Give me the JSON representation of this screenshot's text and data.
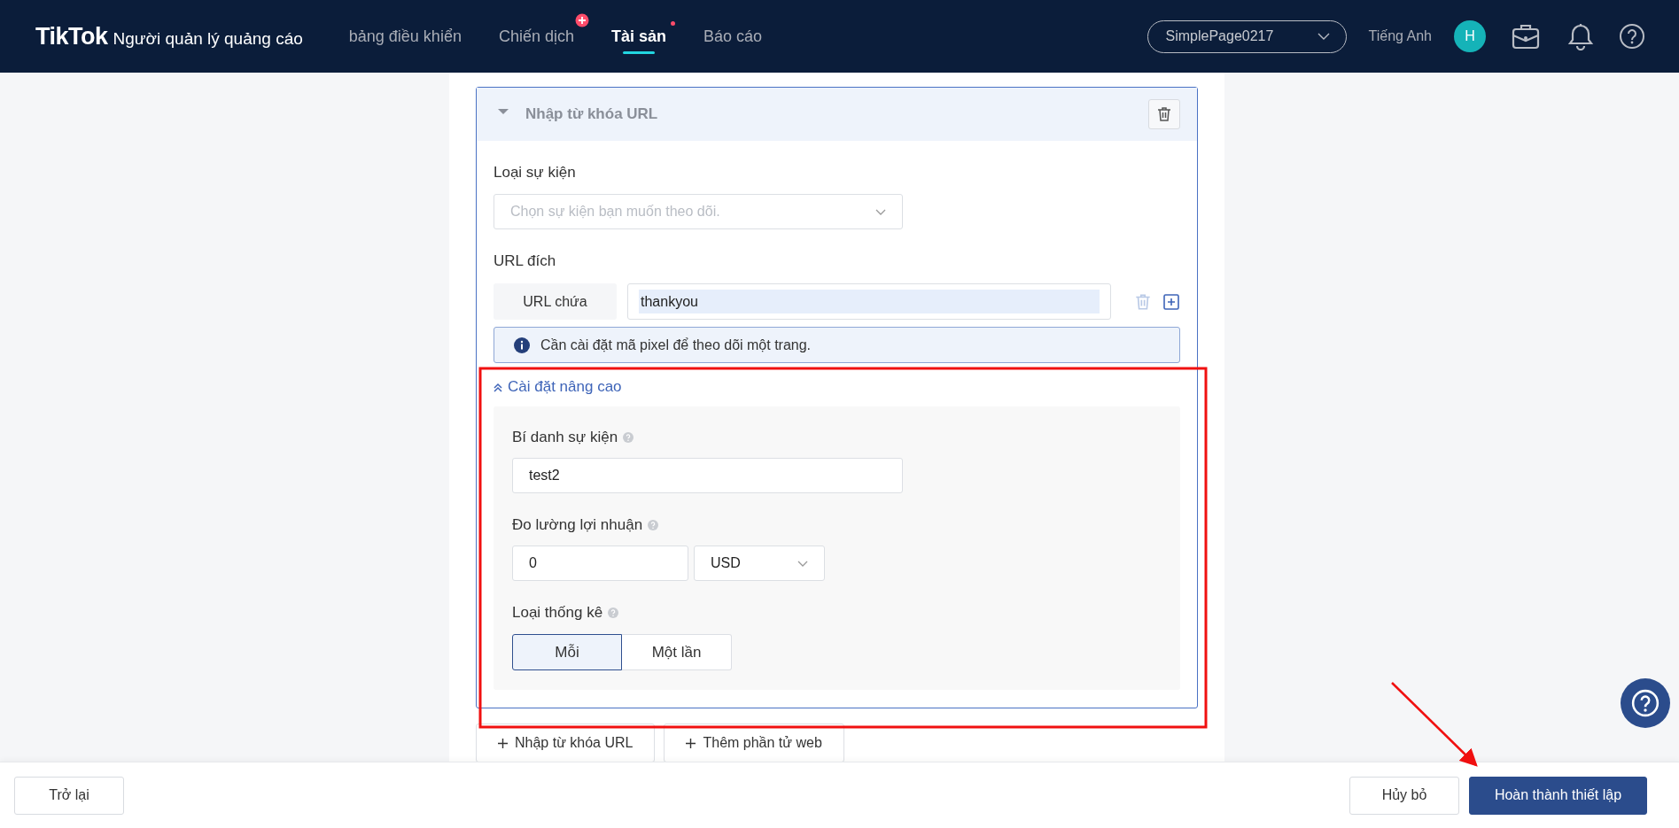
{
  "header": {
    "logo": "TikTok",
    "logo_subtitle": "Người quản lý quảng cáo",
    "nav": [
      {
        "label": "bảng điều khiển",
        "selected": false,
        "kind": "plain"
      },
      {
        "label": "Chiến dịch",
        "selected": false,
        "kind": "plus"
      },
      {
        "label": "Tài sản",
        "selected": true,
        "kind": "dot"
      },
      {
        "label": "Báo cáo",
        "selected": false,
        "kind": "plain"
      }
    ],
    "account": "SimplePage0217",
    "language": "Tiếng Anh",
    "avatar": "H"
  },
  "rule_card": {
    "title": "Nhập từ khóa URL",
    "expanded": true,
    "event_type": {
      "label": "Loại sự kiện",
      "placeholder": "Chọn sự kiện bạn muốn theo dõi."
    },
    "destination": {
      "label": "URL đích",
      "condition": "URL chứa",
      "value": "thankyou"
    },
    "info": "Cần cài đặt mã pixel để theo dõi một trang.",
    "advanced": {
      "label": "Cài đặt nâng cao",
      "expanded": true,
      "alias": {
        "label": "Bí danh sự kiện",
        "value": "test2"
      },
      "revenue": {
        "label": "Đo lường lợi nhuận",
        "value": "0",
        "currency": "USD"
      },
      "count_type": {
        "label": "Loại thống kê",
        "options": [
          {
            "label": "Mỗi",
            "selected": true
          },
          {
            "label": "Một lần",
            "selected": false
          }
        ]
      }
    }
  },
  "add_buttons": [
    "Nhập từ khóa URL",
    "Thêm phần tử web"
  ],
  "footer": {
    "back": "Trở lại",
    "cancel": "Hủy bỏ",
    "finish": "Hoàn thành thiết lập"
  }
}
